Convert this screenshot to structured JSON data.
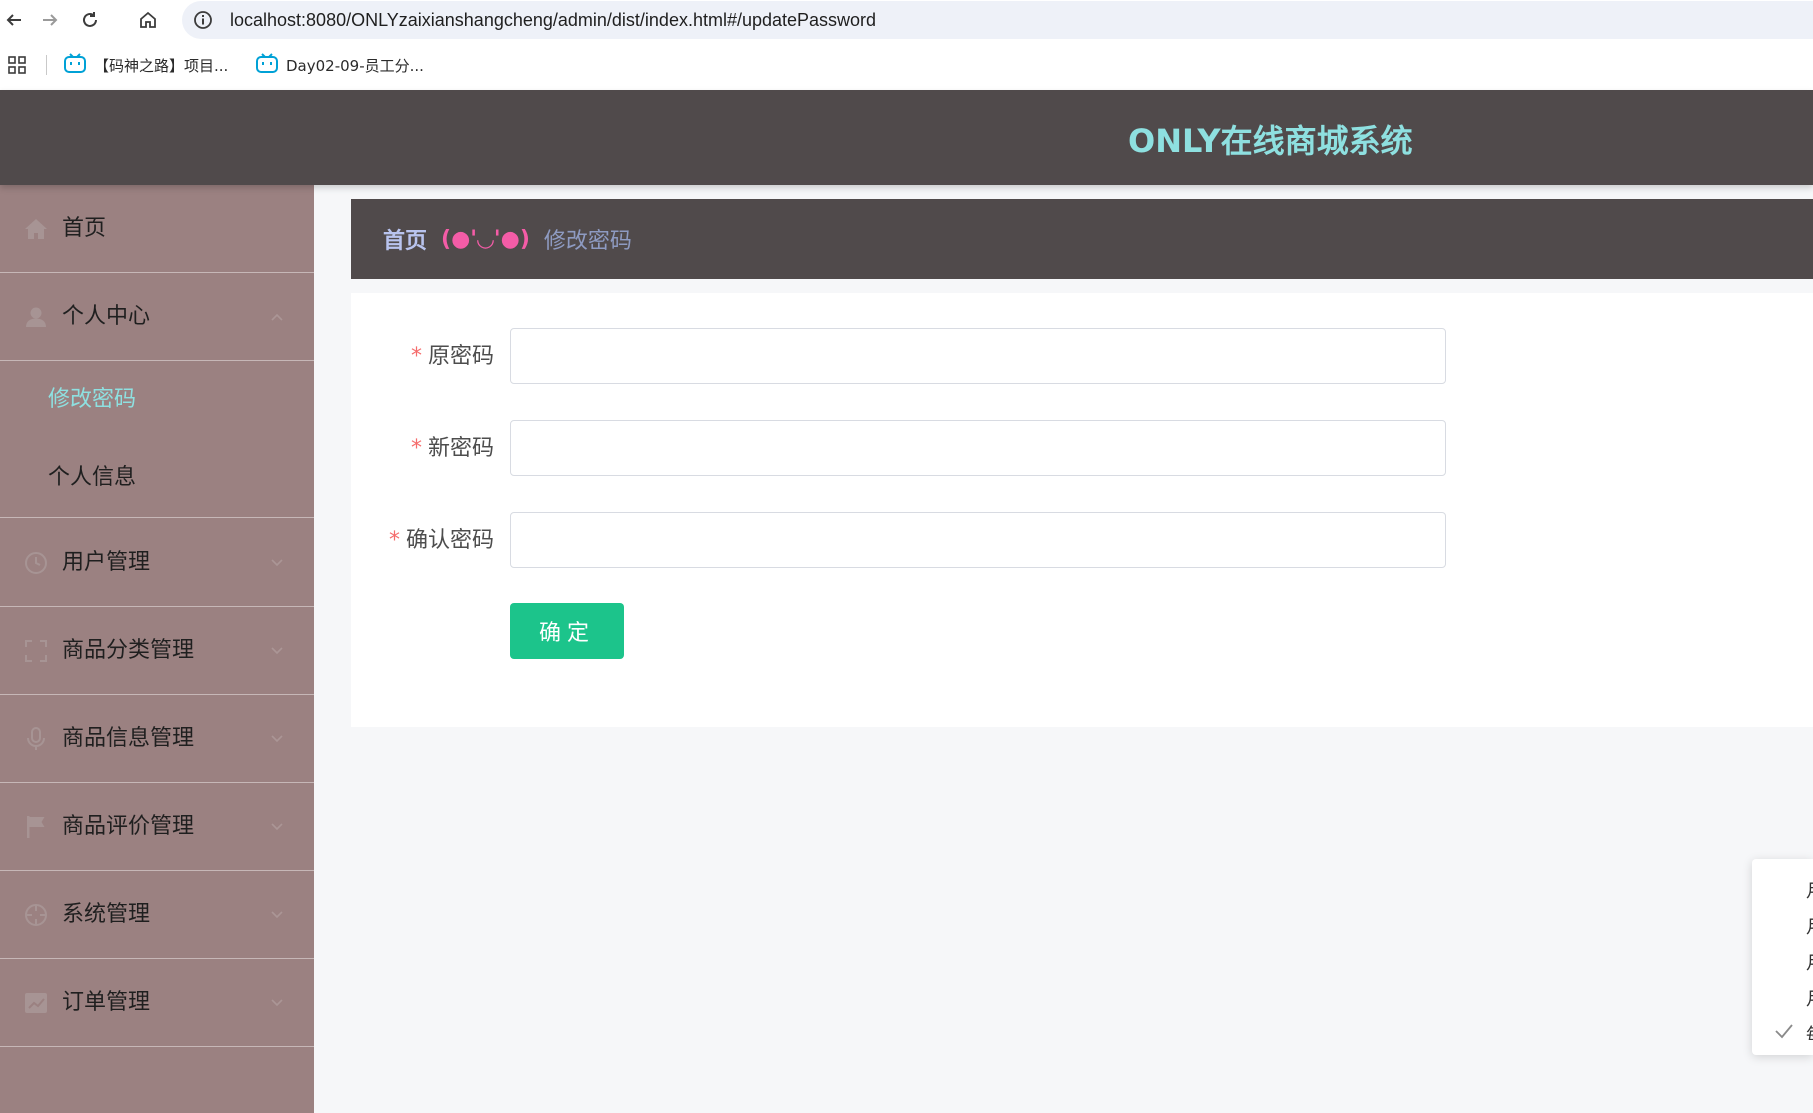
{
  "browser": {
    "url": "localhost:8080/ONLYzaixianshangcheng/admin/dist/index.html#/updatePassword",
    "bookmarks": [
      {
        "label": "【码神之路】项目..."
      },
      {
        "label": "Day02-09-员工分..."
      }
    ]
  },
  "header": {
    "title": "ONLY在线商城系统"
  },
  "sidebar": {
    "items": [
      {
        "label": "首页",
        "icon": "home-icon"
      },
      {
        "label": "个人中心",
        "icon": "user-icon",
        "expanded": true,
        "children": [
          {
            "label": "修改密码",
            "active": true
          },
          {
            "label": "个人信息",
            "active": false
          }
        ]
      },
      {
        "label": "用户管理",
        "icon": "clock-icon"
      },
      {
        "label": "商品分类管理",
        "icon": "scan-icon"
      },
      {
        "label": "商品信息管理",
        "icon": "microphone-icon"
      },
      {
        "label": "商品评价管理",
        "icon": "flag-icon"
      },
      {
        "label": "系统管理",
        "icon": "crosshair-icon"
      },
      {
        "label": "订单管理",
        "icon": "chart-icon"
      }
    ]
  },
  "breadcrumb": {
    "home": "首页",
    "separator": "(●'◡'●)",
    "current": "修改密码"
  },
  "form": {
    "fields": [
      {
        "label": "原密码",
        "value": "",
        "required": true
      },
      {
        "label": "新密码",
        "value": "",
        "required": true
      },
      {
        "label": "确认密码",
        "value": "",
        "required": true
      }
    ],
    "submit_label": "确定"
  },
  "dropdown": {
    "items": [
      "月",
      "月",
      "月",
      "月",
      "每"
    ],
    "checked_index": 4
  },
  "colors": {
    "header_bg": "#504a4b",
    "title": "#8ee0e0",
    "sidebar_bg": "#9b8181",
    "active_sub": "#8ee0e0",
    "submit_bg": "#1cc48b",
    "breadcrumb_sep": "#f45ca7",
    "required_mark": "#f56c6c"
  }
}
